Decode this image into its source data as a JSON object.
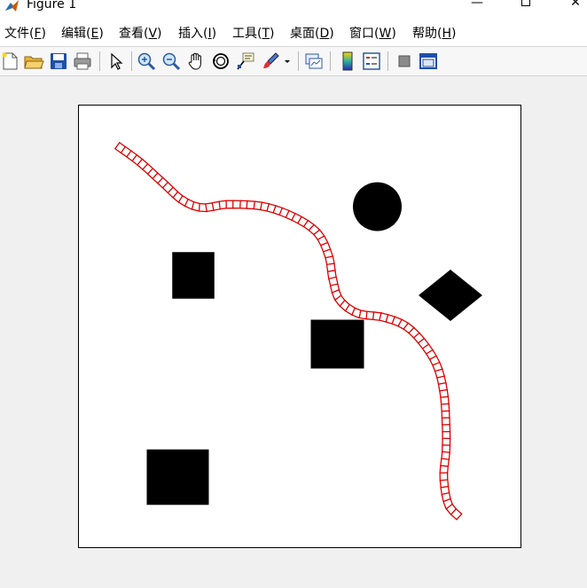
{
  "window": {
    "title": "Figure 1",
    "minimize_glyph": "—",
    "close_glyph": "✕"
  },
  "menu": [
    {
      "label": "文件(",
      "key": "F",
      "end": ")"
    },
    {
      "label": "编辑(",
      "key": "E",
      "end": ")"
    },
    {
      "label": "查看(",
      "key": "V",
      "end": ")"
    },
    {
      "label": "插入(",
      "key": "I",
      "end": ")"
    },
    {
      "label": "工具(",
      "key": "T",
      "end": ")"
    },
    {
      "label": "桌面(",
      "key": "D",
      "end": ")"
    },
    {
      "label": "窗口(",
      "key": "W",
      "end": ")"
    },
    {
      "label": "帮助(",
      "key": "H",
      "end": ")"
    }
  ],
  "toolbar": {
    "icons": [
      "new-figure-icon",
      "open-file-icon",
      "save-icon",
      "print-icon",
      "select-arrow-icon",
      "zoom-in-icon",
      "zoom-out-icon",
      "pan-hand-icon",
      "rotate-3d-icon",
      "data-cursor-icon",
      "brush-icon",
      "link-plot-icon",
      "insert-colorbar-icon",
      "insert-legend-icon",
      "hide-plot-tools-icon",
      "show-plot-tools-icon"
    ]
  },
  "colors": {
    "path": "#dd0000",
    "obstacle": "#000000",
    "axes_bg": "#ffffff",
    "figure_bg": "#f0f0f0"
  },
  "plot": {
    "xlim": [
      0,
      10
    ],
    "ylim": [
      0,
      10
    ],
    "ticks_visible": false,
    "obstacles": [
      {
        "shape": "square",
        "cx": 2.6,
        "cy": 6.15,
        "w": 0.95,
        "h": 1.05
      },
      {
        "shape": "square",
        "cx": 5.85,
        "cy": 4.6,
        "w": 1.2,
        "h": 1.1
      },
      {
        "shape": "square",
        "cx": 2.25,
        "cy": 1.6,
        "w": 1.4,
        "h": 1.25
      },
      {
        "shape": "circle",
        "cx": 6.75,
        "cy": 7.7,
        "r": 0.55
      },
      {
        "shape": "diamond",
        "cx": 8.4,
        "cy": 5.7,
        "rx": 0.72,
        "ry": 0.58
      }
    ],
    "path": [
      [
        0.95,
        9.03
      ],
      [
        1.4,
        8.7
      ],
      [
        1.9,
        8.25
      ],
      [
        2.35,
        7.85
      ],
      [
        2.8,
        7.68
      ],
      [
        3.4,
        7.75
      ],
      [
        4.2,
        7.7
      ],
      [
        4.9,
        7.45
      ],
      [
        5.4,
        7.1
      ],
      [
        5.65,
        6.6
      ],
      [
        5.75,
        6.05
      ],
      [
        5.9,
        5.6
      ],
      [
        6.3,
        5.3
      ],
      [
        6.9,
        5.2
      ],
      [
        7.4,
        5.0
      ],
      [
        7.8,
        4.6
      ],
      [
        8.1,
        4.1
      ],
      [
        8.25,
        3.5
      ],
      [
        8.3,
        2.8
      ],
      [
        8.3,
        2.2
      ],
      [
        8.25,
        1.6
      ],
      [
        8.35,
        1.0
      ],
      [
        8.6,
        0.7
      ]
    ],
    "marker_spacing": 0.15,
    "marker_size": 0.17
  }
}
